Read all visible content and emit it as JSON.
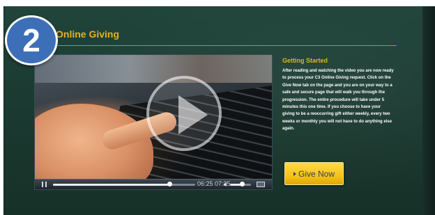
{
  "step": {
    "number": "2"
  },
  "section": {
    "title": "Online Giving"
  },
  "video": {
    "progress": 0.82,
    "volume": 0.55,
    "time_display": "06:25 07:25"
  },
  "info": {
    "heading": "Getting Started",
    "body": "After reading and watching the video you are now ready to process your C3 Online Giving request. Click on the Give Now tab on the page and you are on your way to a safe and secure page that will walk you through the progression. The entire procedure will take under 5 minutes this one time. If you choose to have your giving to be a reoccurring gift either weekly, every two weeks or monthly you will not have to do anything else again."
  },
  "cta": {
    "label": "Give Now"
  },
  "colors": {
    "accent": "#e2b31f",
    "badge": "#3d6fb8",
    "background": "#1b3a31",
    "button": "#f5c414",
    "button_text": "#2f3c6b"
  }
}
